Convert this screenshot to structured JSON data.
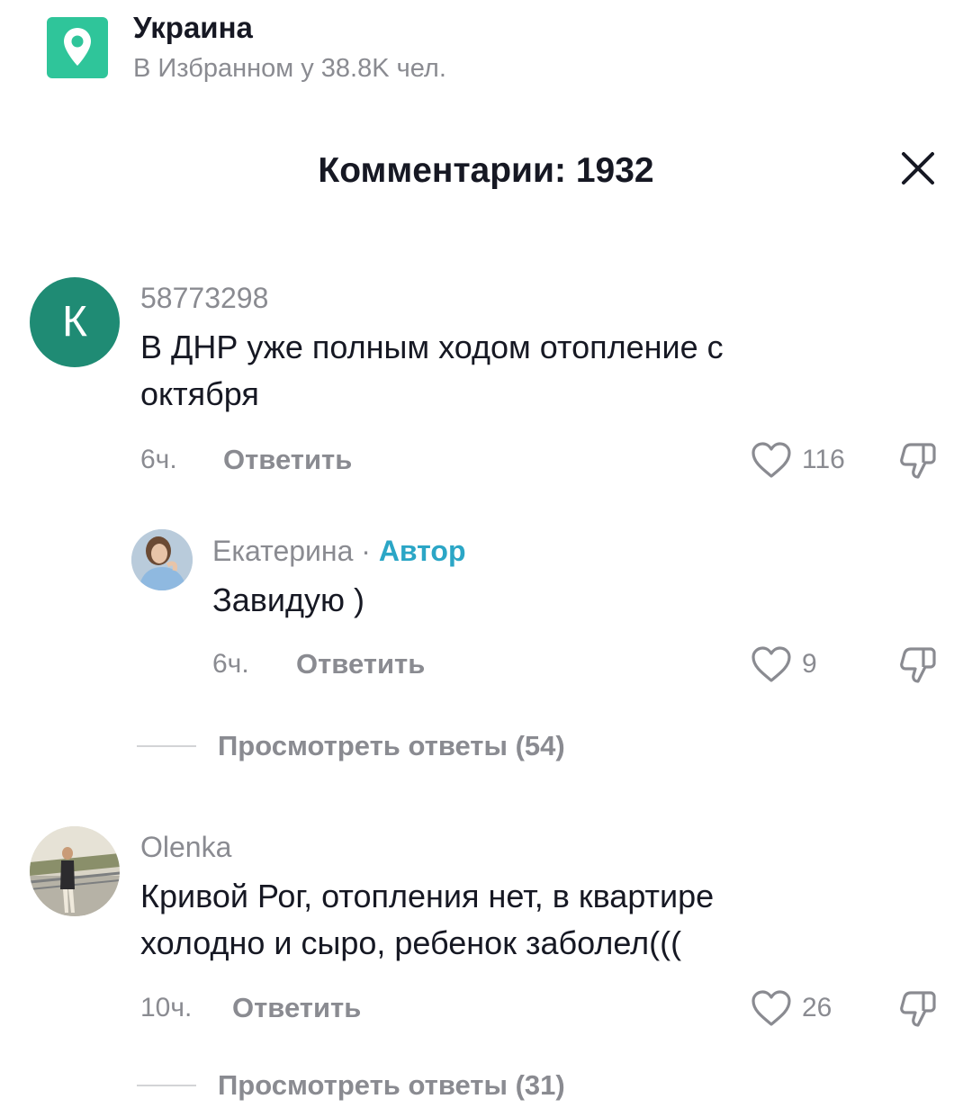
{
  "location": {
    "title": "Украина",
    "subtitle": "В Избранном у 38.8K чел.",
    "icon": "location-pin-icon",
    "accent": "#2fc59a"
  },
  "comments_header": {
    "title": "Комментарии: 1932",
    "close_icon": "close-icon"
  },
  "comments": [
    {
      "username": "58773298",
      "avatar_letter": "К",
      "avatar_color": "#1f8b74",
      "text": "В ДНР уже полным ходом отопление с октября",
      "time": "6ч.",
      "reply_label": "Ответить",
      "likes": "116"
    },
    {
      "username": "Екатерина",
      "author_separator": "·",
      "author_label": "Автор",
      "text": "Завидую )",
      "time": "6ч.",
      "reply_label": "Ответить",
      "likes": "9"
    },
    {
      "username": "Olenka",
      "text": "Кривой Рог, отопления нет, в квартире холодно и сыро, ребенок заболел(((",
      "time": "10ч.",
      "reply_label": "Ответить",
      "likes": "26"
    }
  ],
  "view_replies": [
    "Просмотреть ответы (54)",
    "Просмотреть ответы (31)"
  ],
  "colors": {
    "author_tag": "#2ba6c6",
    "secondary_text": "#8a8b91",
    "primary_text": "#161823"
  }
}
